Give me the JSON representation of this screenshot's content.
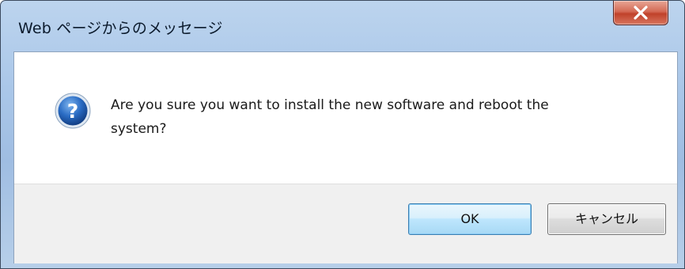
{
  "window": {
    "title": "Web ページからのメッセージ"
  },
  "message": {
    "line1": "Are you sure you want to install the new software and reboot the",
    "line2": "system?"
  },
  "icons": {
    "question": "question-icon",
    "close": "close-icon"
  },
  "buttons": {
    "ok_label": "OK",
    "cancel_label": "キャンセル"
  },
  "colors": {
    "close_button": "#c0412a",
    "default_button_border": "#3c7fb1",
    "question_icon": "#1e5fb3"
  }
}
